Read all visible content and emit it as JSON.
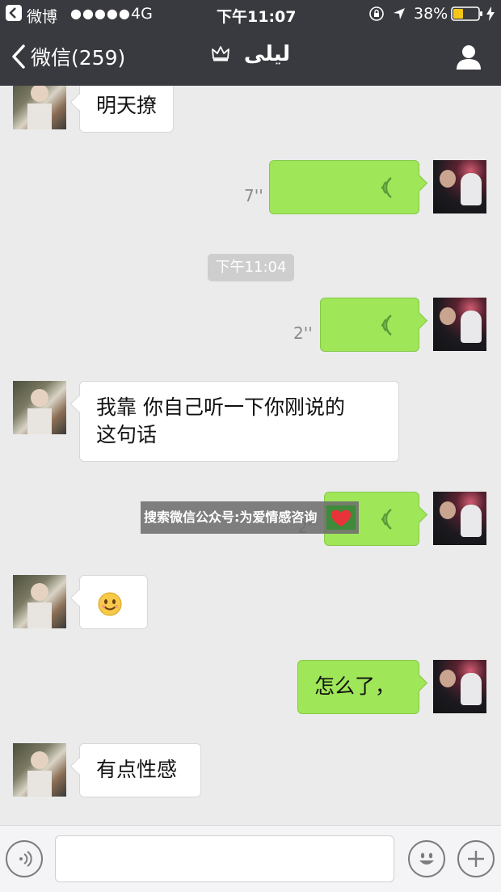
{
  "status_bar": {
    "back_app": "微博",
    "signal": "●●●●●",
    "network": "4G",
    "time": "下午11:07",
    "battery": "38%",
    "icons": [
      "rotation-lock-icon",
      "location-arrow-icon",
      "battery-icon",
      "charging-bolt-icon"
    ]
  },
  "nav": {
    "back_label": "微信(259)",
    "title": "ليلى",
    "title_icon": "crown-icon",
    "profile_icon": "person-icon"
  },
  "messages": [
    {
      "from": "her",
      "type": "text",
      "text": "明天撩"
    },
    {
      "from": "me",
      "type": "voice",
      "duration": "7''"
    },
    {
      "type": "time",
      "text": "下午11:04"
    },
    {
      "from": "me",
      "type": "voice",
      "duration": "2''"
    },
    {
      "from": "her",
      "type": "text",
      "lines": [
        "我靠 你自己听一下你刚说的",
        "这句话"
      ]
    },
    {
      "from": "me",
      "type": "voice",
      "duration": "2''"
    },
    {
      "from": "her",
      "type": "emoji",
      "emoji": "smile-emoji"
    },
    {
      "from": "me",
      "type": "text",
      "text": "怎么了，"
    },
    {
      "from": "her",
      "type": "text",
      "text": "有点性感"
    }
  ],
  "watermark": {
    "text": "搜索微信公众号:为爱情感咨询"
  },
  "input_bar": {
    "voice_icon": "voice-input-icon",
    "emoji_icon": "emoji-icon",
    "plus_icon": "plus-icon"
  },
  "colors": {
    "header_bg": "#393a3f",
    "chat_bg": "#ebebeb",
    "my_bubble": "#9fe658",
    "their_bubble": "#ffffff"
  }
}
